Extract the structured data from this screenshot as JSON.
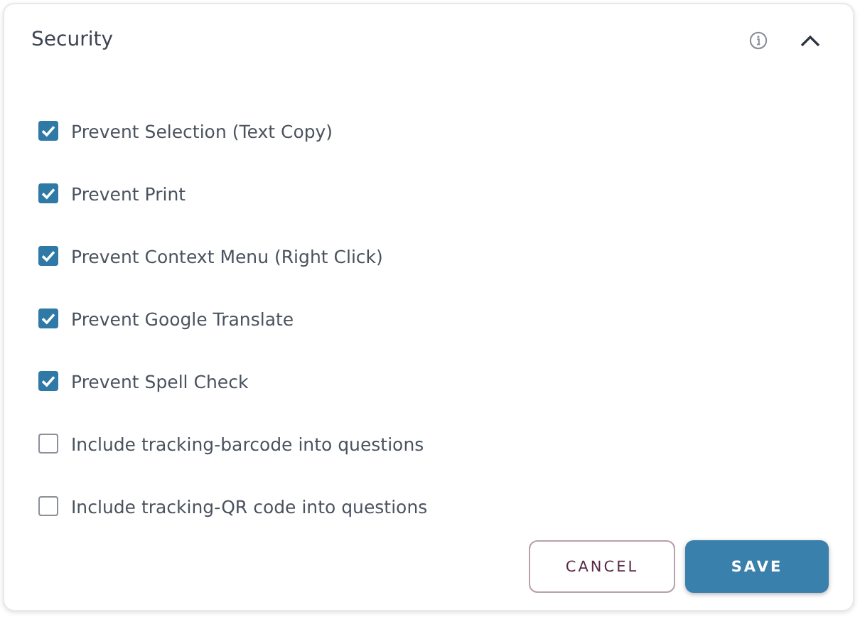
{
  "panel": {
    "title": "Security",
    "expanded": true
  },
  "options": [
    {
      "label": "Prevent Selection (Text Copy)",
      "checked": true
    },
    {
      "label": "Prevent Print",
      "checked": true
    },
    {
      "label": "Prevent Context Menu (Right Click)",
      "checked": true
    },
    {
      "label": "Prevent Google Translate",
      "checked": true
    },
    {
      "label": "Prevent Spell Check",
      "checked": true
    },
    {
      "label": "Include tracking-barcode into questions",
      "checked": false
    },
    {
      "label": "Include tracking-QR code into questions",
      "checked": false
    }
  ],
  "buttons": [
    {
      "label": "CANCEL",
      "kind": "secondary"
    },
    {
      "label": "SAVE",
      "kind": "primary"
    }
  ]
}
